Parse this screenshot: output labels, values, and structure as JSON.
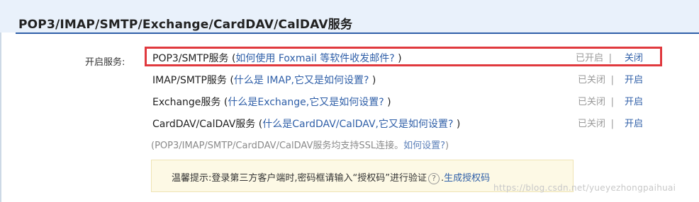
{
  "section": {
    "title": "POP3/IMAP/SMTP/Exchange/CardDAV/CalDAV服务"
  },
  "service_label": "开启服务:",
  "rows": [
    {
      "name": "POP3/SMTP服务",
      "help": "如何使用 Foxmail 等软件收发邮件?",
      "status": "已开启",
      "action": "关闭",
      "highlighted": true
    },
    {
      "name": "IMAP/SMTP服务",
      "help": "什么是 IMAP,它又是如何设置?",
      "status": "已关闭",
      "action": "开启",
      "highlighted": false
    },
    {
      "name": "Exchange服务",
      "help": "什么是Exchange,它又是如何设置?",
      "status": "已关闭",
      "action": "开启",
      "highlighted": false
    },
    {
      "name": "CardDAV/CalDAV服务",
      "help": "什么是CardDAV/CalDAV,它又是如何设置?",
      "status": "已关闭",
      "action": "开启",
      "highlighted": false
    }
  ],
  "ssl_note": {
    "text": "(POP3/IMAP/SMTP/CardDAV/CalDAV服务均支持SSL连接。",
    "link": "如何设置?",
    "close": ")"
  },
  "tip": {
    "text": "温馨提示:登录第三方客户端时,密码框请输入“授权码”进行验证",
    "help_glyph": "?",
    "link": "生成授权码"
  },
  "watermark": "https://blog.csdn.net/yueyezhongpaihuai",
  "colors": {
    "link": "#2f5fa8",
    "highlight_border": "#e0393e",
    "header_bg": "#e9f1fb",
    "tip_bg": "#fdf9e5"
  }
}
